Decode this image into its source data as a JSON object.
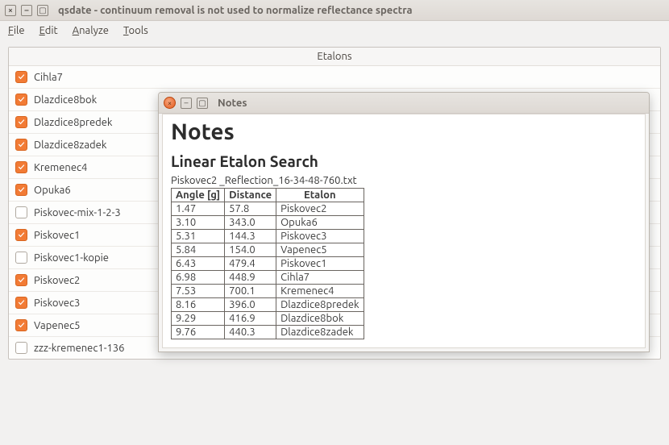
{
  "main_window": {
    "title": "qsdate - continuum removal is not used to normalize reflectance spectra",
    "menus": {
      "file": "File",
      "edit": "Edit",
      "analyze": "Analyze",
      "tools": "Tools"
    },
    "panel_header": "Etalons",
    "items": [
      {
        "label": "Cihla7",
        "checked": true
      },
      {
        "label": "Dlazdice8bok",
        "checked": true
      },
      {
        "label": "Dlazdice8predek",
        "checked": true
      },
      {
        "label": "Dlazdice8zadek",
        "checked": true
      },
      {
        "label": "Kremenec4",
        "checked": true
      },
      {
        "label": "Opuka6",
        "checked": true
      },
      {
        "label": "Piskovec-mix-1-2-3",
        "checked": false
      },
      {
        "label": "Piskovec1",
        "checked": true
      },
      {
        "label": "Piskovec1-kopie",
        "checked": false
      },
      {
        "label": "Piskovec2",
        "checked": true
      },
      {
        "label": "Piskovec3",
        "checked": true
      },
      {
        "label": "Vapenec5",
        "checked": true
      },
      {
        "label": "zzz-kremenec1-136",
        "checked": false
      }
    ]
  },
  "notes_window": {
    "title": "Notes",
    "heading": "Notes",
    "subheading": "Linear Etalon Search",
    "filename": "Piskovec2 _Reflection_16-34-48-760.txt",
    "columns": {
      "angle": "Angle [g]",
      "distance": "Distance",
      "etalon": "Etalon"
    },
    "rows": [
      {
        "angle": "1.47",
        "distance": "57.8",
        "etalon": "Piskovec2"
      },
      {
        "angle": "3.10",
        "distance": "343.0",
        "etalon": "Opuka6"
      },
      {
        "angle": "5.31",
        "distance": "144.3",
        "etalon": "Piskovec3"
      },
      {
        "angle": "5.84",
        "distance": "154.0",
        "etalon": "Vapenec5"
      },
      {
        "angle": "6.43",
        "distance": "479.4",
        "etalon": "Piskovec1"
      },
      {
        "angle": "6.98",
        "distance": "448.9",
        "etalon": "Cihla7"
      },
      {
        "angle": "7.53",
        "distance": "700.1",
        "etalon": "Kremenec4"
      },
      {
        "angle": "8.16",
        "distance": "396.0",
        "etalon": "Dlazdice8predek"
      },
      {
        "angle": "9.29",
        "distance": "416.9",
        "etalon": "Dlazdice8bok"
      },
      {
        "angle": "9.76",
        "distance": "440.3",
        "etalon": "Dlazdice8zadek"
      }
    ]
  }
}
